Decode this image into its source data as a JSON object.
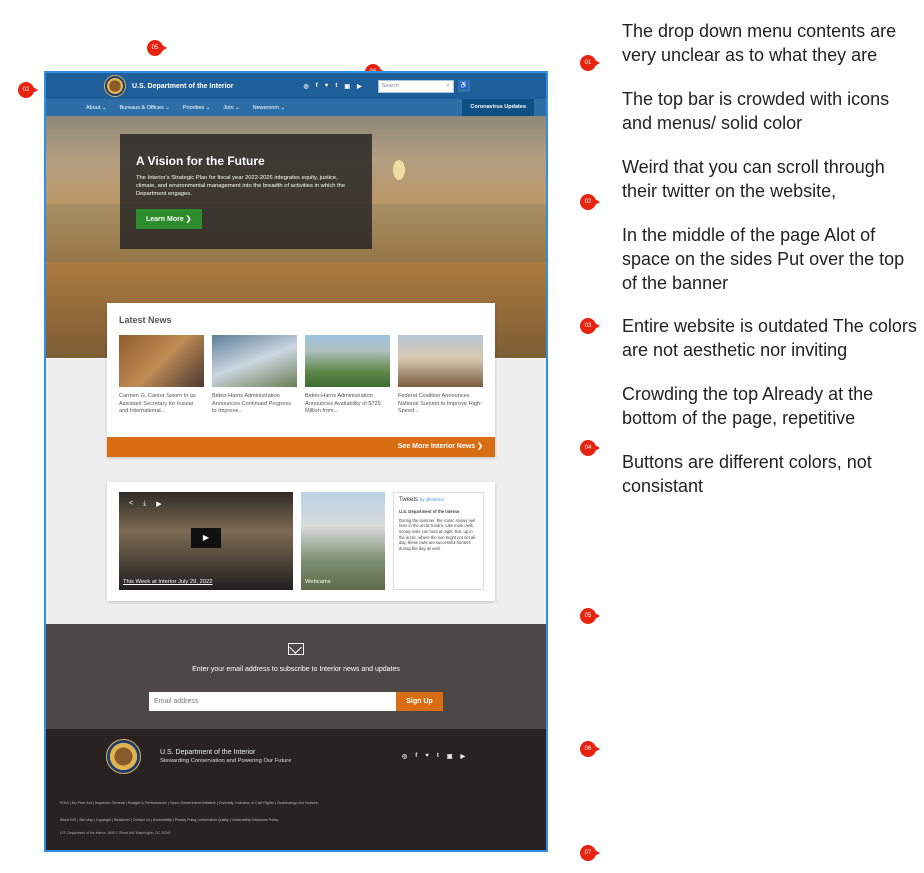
{
  "site": {
    "title": "U.S. Department of the Interior",
    "search_placeholder": "Search",
    "nav": [
      "About ⌄",
      "Bureaus & Offices ⌄",
      "Priorities ⌄",
      "Join ⌄",
      "Newsroom ⌄"
    ],
    "covid": "Coronavirus Updates",
    "social_icons": [
      "instagram-icon",
      "facebook-icon",
      "twitter-icon",
      "tumblr-icon",
      "flickr-icon",
      "youtube-icon"
    ],
    "social_glyphs": [
      "◎",
      "f",
      "♥",
      "t",
      "▣",
      "▶"
    ]
  },
  "hero": {
    "title": "A Vision for the Future",
    "text": "The Interior's Strategic Plan for fiscal year 2022-2026 integrates equity, justice, climate, and environmental management into the breadth of activities in which the Department engages.",
    "button": "Learn More ❯"
  },
  "news": {
    "heading": "Latest News",
    "items": [
      "Carmen G. Cantor Sworn In as Assistant Secretary for Insular and International...",
      "Biden-Harris Administration Announces Continued Progress to Improve...",
      "Biden-Harris Administration Announces Availability of $725 Million from...",
      "Federal Coalition Announces National Summit to Improve High-Speed..."
    ],
    "more": "See More Interior News ❯"
  },
  "media": {
    "video_caption": "This Week at Interior July 29, 2022",
    "webcams": "Webcams",
    "tweets_title": "Tweets",
    "tweets_handle": "by @Interior",
    "tweet_author": "U.S. Department of the Interior",
    "tweet_text": "During the summer, the iconic snowy owl lives in the arctic tundra. Like most owls, snowy owls can hunt at night. But, up in the arctic, where the sun might not set all day, these owls are successful hunters during the day as well."
  },
  "subscribe": {
    "text": "Enter your email address to subscribe to Interior news and updates",
    "placeholder": "Email address",
    "button": "Sign Up"
  },
  "footer": {
    "name": "U.S. Department of the Interior",
    "tagline": "Stewarding Conservation and Powering Our Future",
    "links": "FOIA | No Fear Act | Inspector General | Budget & Performance | Open Government Initiative | Diversity, Inclusion & Civil Rights | Guanicango Act Notices",
    "links2": "About DOI | Site Map | Copyright | Disclaimer | Contact Us | Accessibility | Privacy Policy | Information Quality | Vulnerability Disclosure Policy",
    "address": "U.S. Department of the Interior 1849 C Street NW Washington, DC 20240"
  },
  "notes": [
    "The drop down menu contents are very unclear as to what they are",
    "The top bar is crowded with icons and menus/ solid color",
    "Weird that you can scroll through their twitter on the website,",
    "In the middle of the page Alot of space on the sides Put over the top of the banner",
    "Entire website is outdated The colors are not aesthetic nor inviting",
    "Crowding the top Already at the bottom of the page, repetitive",
    "Buttons are different colors, not consistant"
  ],
  "markers": [
    "01",
    "02",
    "03",
    "04",
    "05",
    "06",
    "07"
  ]
}
